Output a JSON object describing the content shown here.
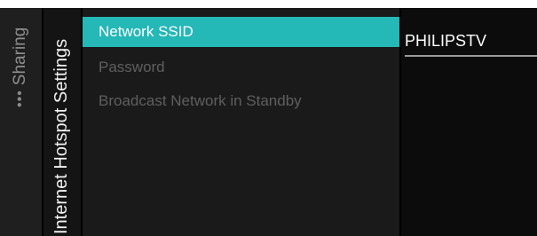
{
  "breadcrumb": {
    "dots": "•••",
    "label": "Sharing"
  },
  "section": {
    "title": "Internet Hotspot Settings"
  },
  "menu": {
    "items": [
      {
        "label": "Network SSID",
        "selected": true
      },
      {
        "label": "Password",
        "selected": false
      },
      {
        "label": "Broadcast Network in Standby",
        "selected": false
      }
    ]
  },
  "detail": {
    "value": "PHILIPSTV"
  },
  "colors": {
    "accent": "#24b8b6",
    "background": "#000000",
    "text_primary": "#ffffff",
    "text_disabled": "#5f5f5f"
  }
}
